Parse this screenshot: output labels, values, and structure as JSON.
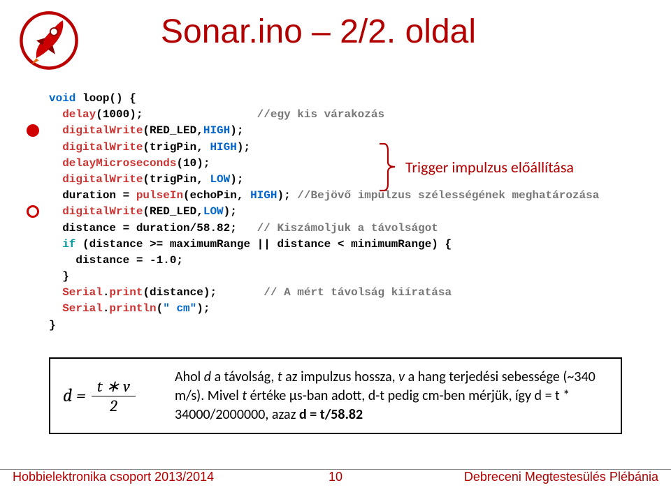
{
  "title": "Sonar.ino – 2/2. oldal",
  "trigger_label": "Trigger impulzus előállítása",
  "code": {
    "l1a": "void ",
    "l1b": "loop",
    "l1c": "() {",
    "l2a": "  delay",
    "l2b": "(1000);                 ",
    "l2c": "//egy kis várakozás",
    "l3a": "  digitalWrite",
    "l3b": "(RED_LED,",
    "l3c": "HIGH",
    "l3d": ");",
    "l4a": "  digitalWrite",
    "l4b": "(trigPin, ",
    "l4c": "HIGH",
    "l4d": ");",
    "l5a": "  delayMicroseconds",
    "l5b": "(10);",
    "l6a": "  digitalWrite",
    "l6b": "(trigPin, ",
    "l6c": "LOW",
    "l6d": ");",
    "l7a": "  duration = ",
    "l7b": "pulseIn",
    "l7c": "(echoPin, ",
    "l7d": "HIGH",
    "l7e": "); ",
    "l7f": "//Bejövő impulzus szélességének meghatározása",
    "l8a": "  digitalWrite",
    "l8b": "(RED_LED,",
    "l8c": "LOW",
    "l8d": ");",
    "l9a": "  distance = duration/58.82;   ",
    "l9b": "// Kiszámoljuk a távolságot",
    "l10a": "  if",
    "l10b": " (distance >= maximumRange || distance < minimumRange) {",
    "l11": "    distance = -1.0;",
    "l12": "  }",
    "l13a": "  Serial",
    "l13b": ".",
    "l13c": "print",
    "l13d": "(distance);       ",
    "l13e": "// A mért távolság kiíratása",
    "l14a": "  Serial",
    "l14b": ".",
    "l14c": "println",
    "l14d": "(",
    "l14e": "\" cm\"",
    "l14f": ");",
    "l15": "}"
  },
  "formula": {
    "lhs": "d =",
    "num": "t ∗ v",
    "den": "2",
    "text1": "Ahol  ",
    "text1b": "d",
    "text1c": " a távolság, ",
    "text1d": "t",
    "text1e": " az impulzus hossza, ",
    "text1f": "v",
    "text1g": " a hang terjedési sebessége (~340 m/s). Mivel ",
    "text1h": "t",
    "text1i": " értéke  μs-ban adott, d-t pedig cm-ben mérjük, így d = t * 34000/2000000, azaz ",
    "text1j": "d = t/58.82"
  },
  "footer": {
    "left": "Hobbielektronika csoport 2013/2014",
    "mid": "10",
    "right": "Debreceni Megtestesülés Plébánia"
  }
}
